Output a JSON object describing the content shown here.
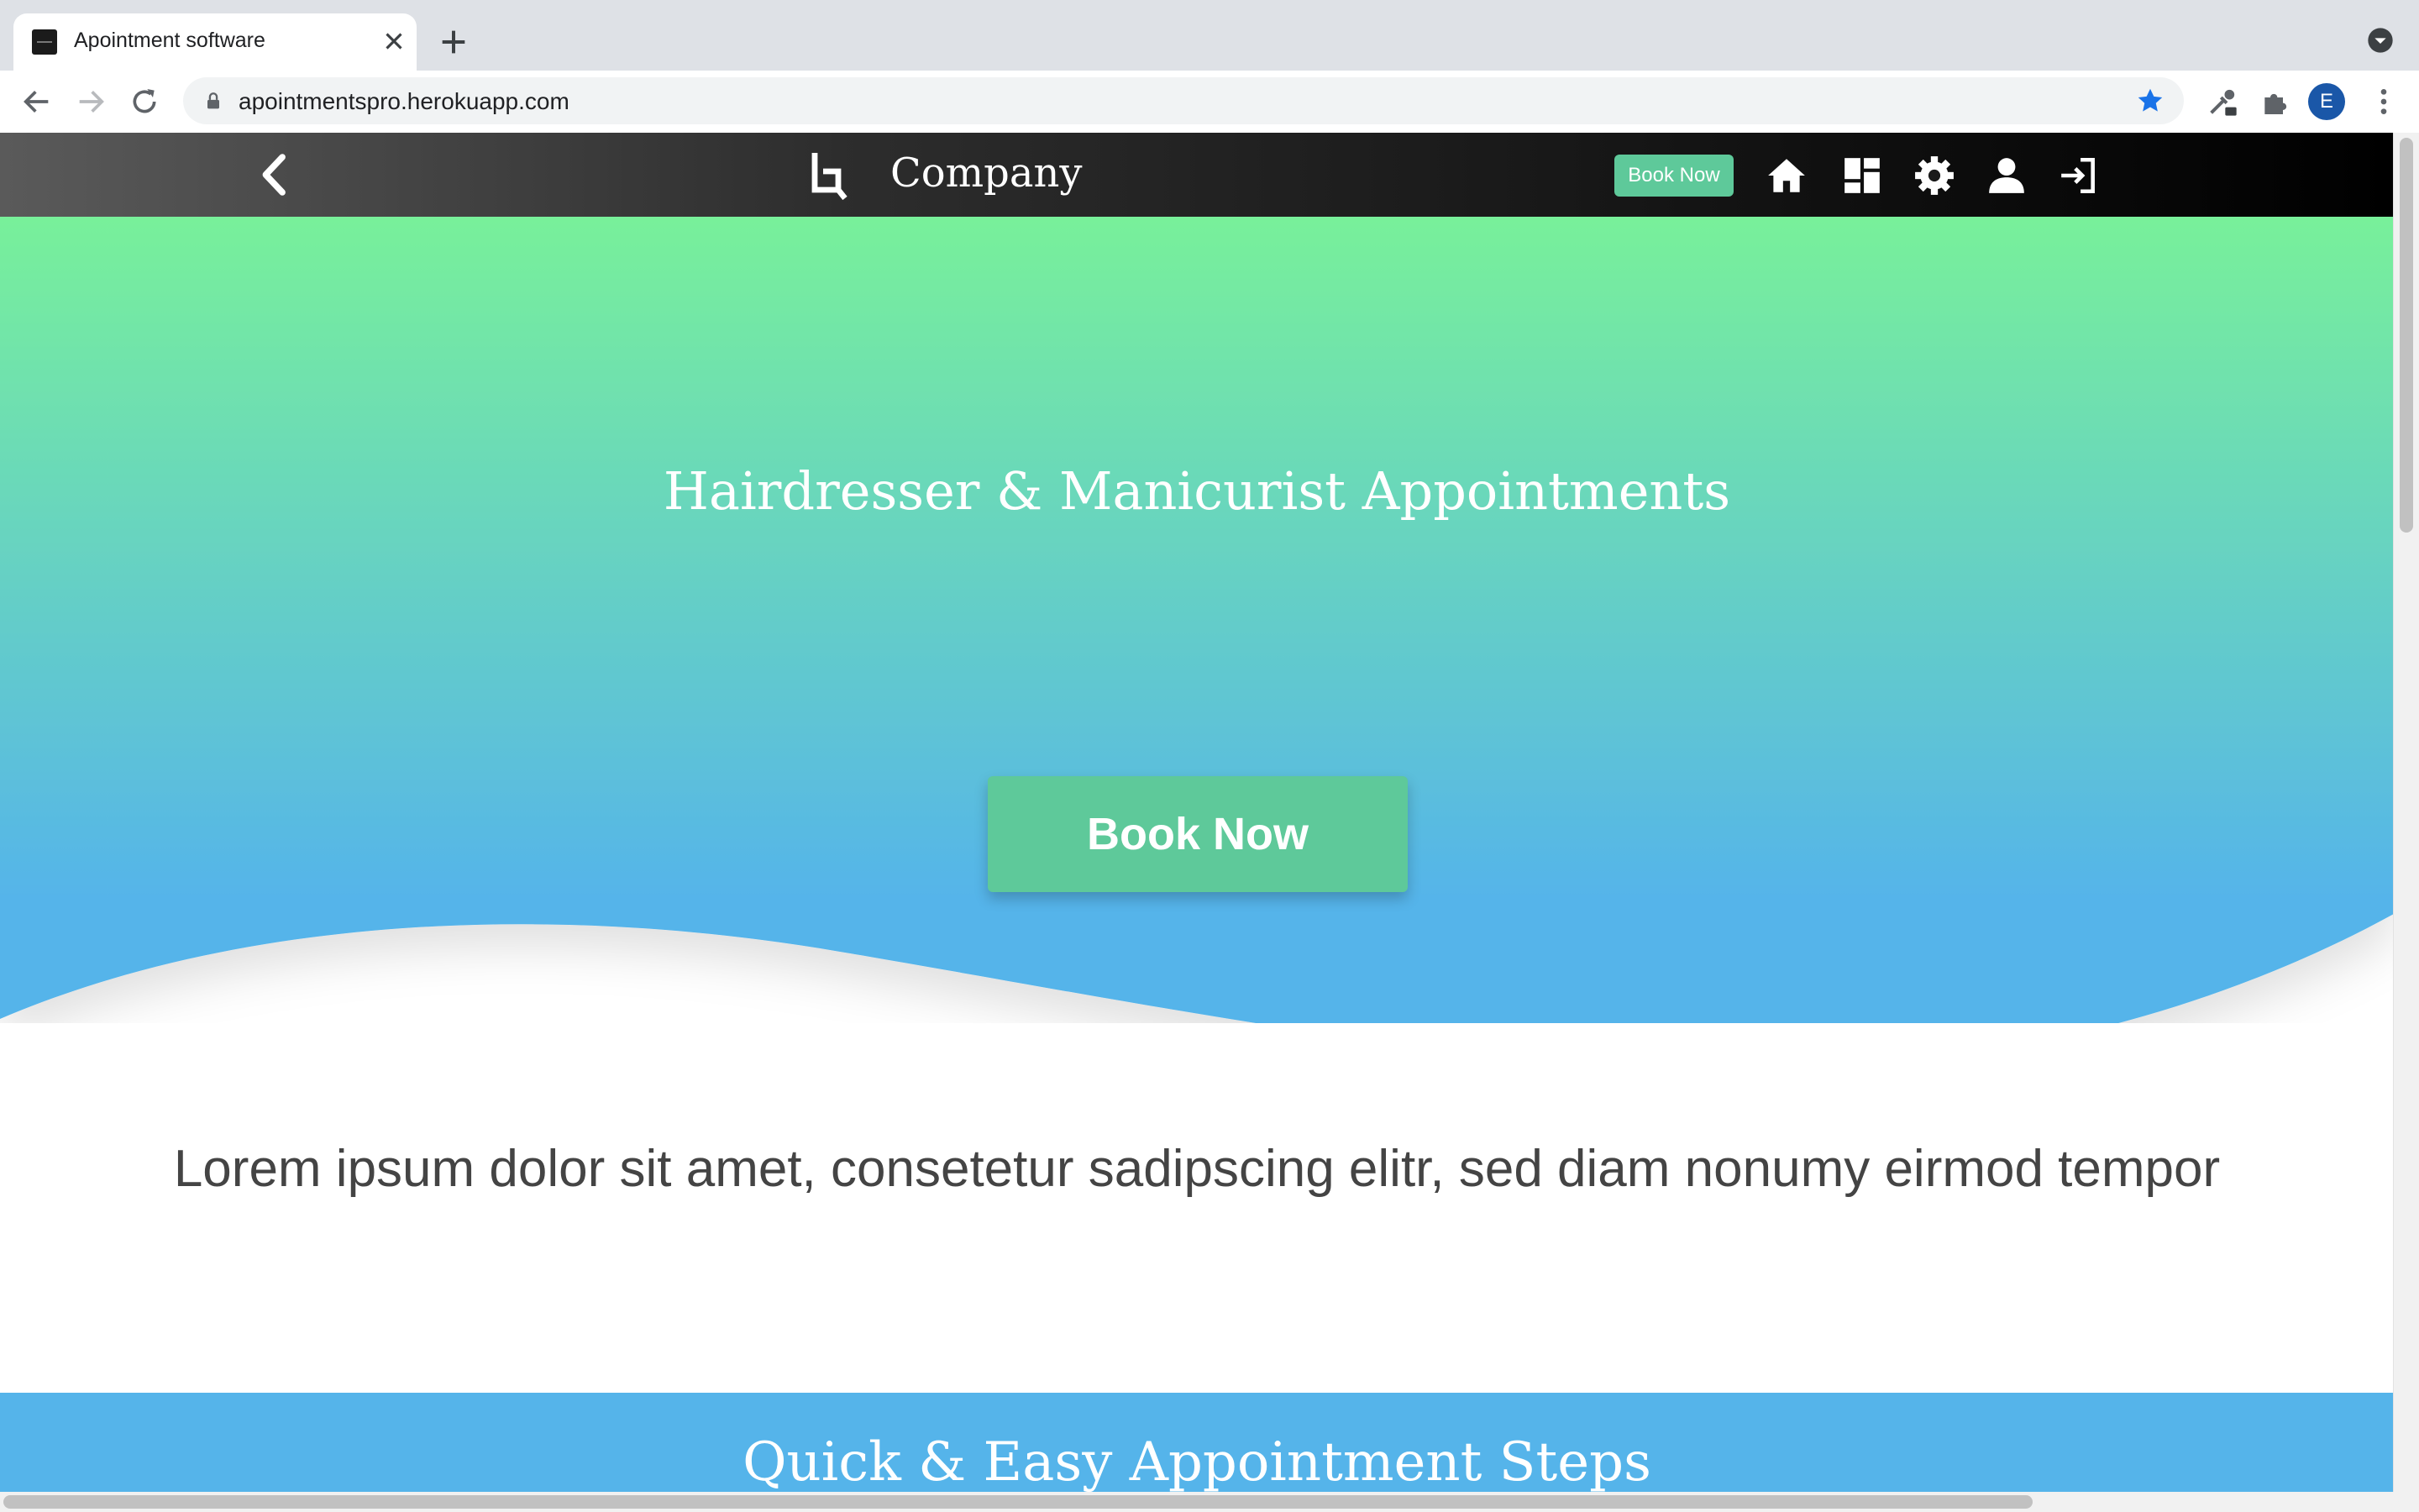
{
  "browser": {
    "tab_title": "Apointment software",
    "url": "apointmentspro.herokuapp.com",
    "profile_initial": "E"
  },
  "site_nav": {
    "brand": "Company",
    "book_label": "Book Now",
    "icons": [
      "back-icon",
      "logo-icon",
      "home-icon",
      "dashboard-icon",
      "settings-icon",
      "user-icon",
      "login-icon"
    ]
  },
  "hero": {
    "title": "Hairdresser & Manicurist Appointments",
    "cta_label": "Book Now"
  },
  "intro": {
    "text": "Lorem ipsum dolor sit amet, consetetur sadipscing elitr, sed diam nonumy eirmod tempor"
  },
  "steps": {
    "title": "Quick & Easy Appointment Steps"
  },
  "colors": {
    "accent": "#5ec99a",
    "hero_top": "#78f09a",
    "hero_bottom": "#55b4ea",
    "nav_bg": "#000000"
  }
}
